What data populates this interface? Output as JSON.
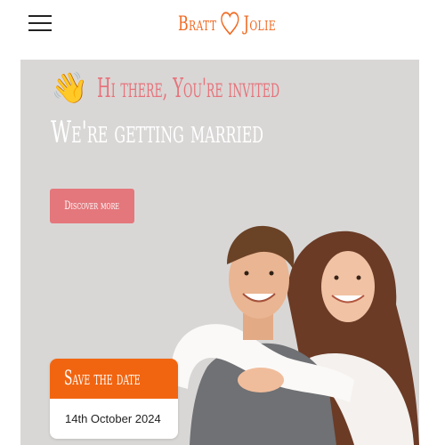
{
  "header": {
    "brand_left": "Bratt",
    "brand_right": "Jolie",
    "brand_color": "#f06a22",
    "menu_icon": "hamburger-menu-icon",
    "brand_icon": "heart-outline-icon"
  },
  "hero": {
    "greeting_icon": "waving-hand-emoji",
    "greeting": "Hi there, You're invited",
    "headline": "We're getting married",
    "cta_label": "Discover more",
    "background_color": "#d9d7d6",
    "accent_color": "#e4777c",
    "photo": "couple-photo"
  },
  "save_the_date": {
    "title": "Save the date",
    "date": "14th October 2024",
    "header_color": "#f26510"
  }
}
